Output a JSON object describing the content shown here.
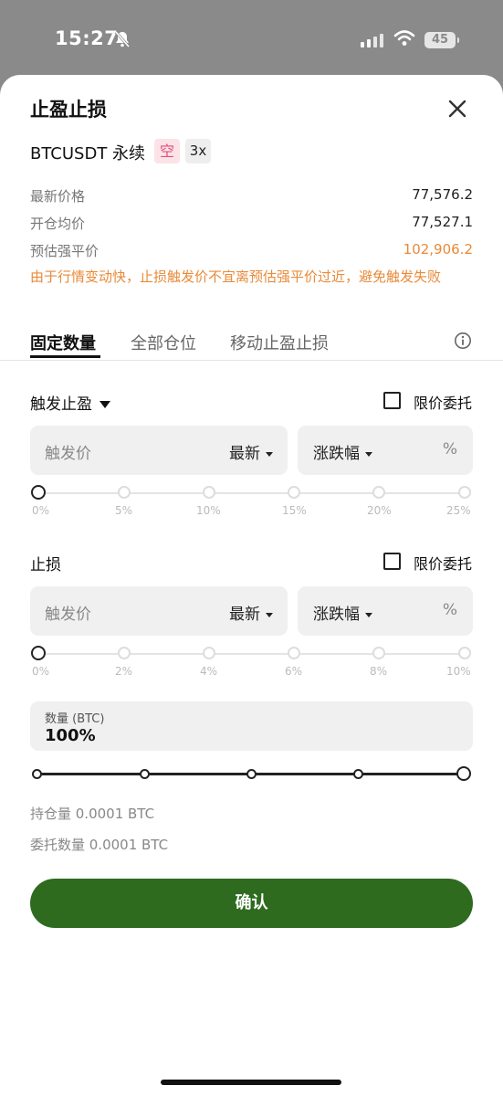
{
  "status_bar": {
    "time": "15:27",
    "battery": "45"
  },
  "sheet": {
    "title": "止盈止损",
    "symbol": "BTCUSDT 永续",
    "side_badge": "空",
    "leverage_badge": "3x"
  },
  "info_rows": [
    {
      "label": "最新价格",
      "value": "77,576.2"
    },
    {
      "label": "开仓均价",
      "value": "77,527.1"
    },
    {
      "label": "预估强平价",
      "value": "102,906.2"
    }
  ],
  "warning": "由于行情变动快，止损触发价不宜离预估强平价过近，避免触发失败",
  "tabs": [
    "固定数量",
    "全部仓位",
    "移动止盈止损"
  ],
  "take_profit": {
    "label": "触发止盈",
    "limit_label": "限价委托",
    "trigger_placeholder": "触发价",
    "price_type": "最新",
    "change_type": "涨跌幅",
    "unit": "%",
    "ticks": [
      "0%",
      "5%",
      "10%",
      "15%",
      "20%",
      "25%"
    ],
    "slider_value_percent": 0
  },
  "stop_loss": {
    "label": "止损",
    "limit_label": "限价委托",
    "trigger_placeholder": "触发价",
    "price_type": "最新",
    "change_type": "涨跌幅",
    "unit": "%",
    "ticks": [
      "0%",
      "2%",
      "4%",
      "6%",
      "8%",
      "10%"
    ],
    "slider_value_percent": 0
  },
  "quantity": {
    "label": "数量 (BTC)",
    "value": "100%",
    "slider_fraction": 1.0
  },
  "position_info": {
    "holding": "持仓量 0.0001 BTC",
    "order_qty": "委托数量 0.0001 BTC"
  },
  "confirm_label": "确认",
  "colors": {
    "accent_green": "#2e6b1f",
    "warning_orange": "#e98a38",
    "short_badge": "#e0527a"
  }
}
